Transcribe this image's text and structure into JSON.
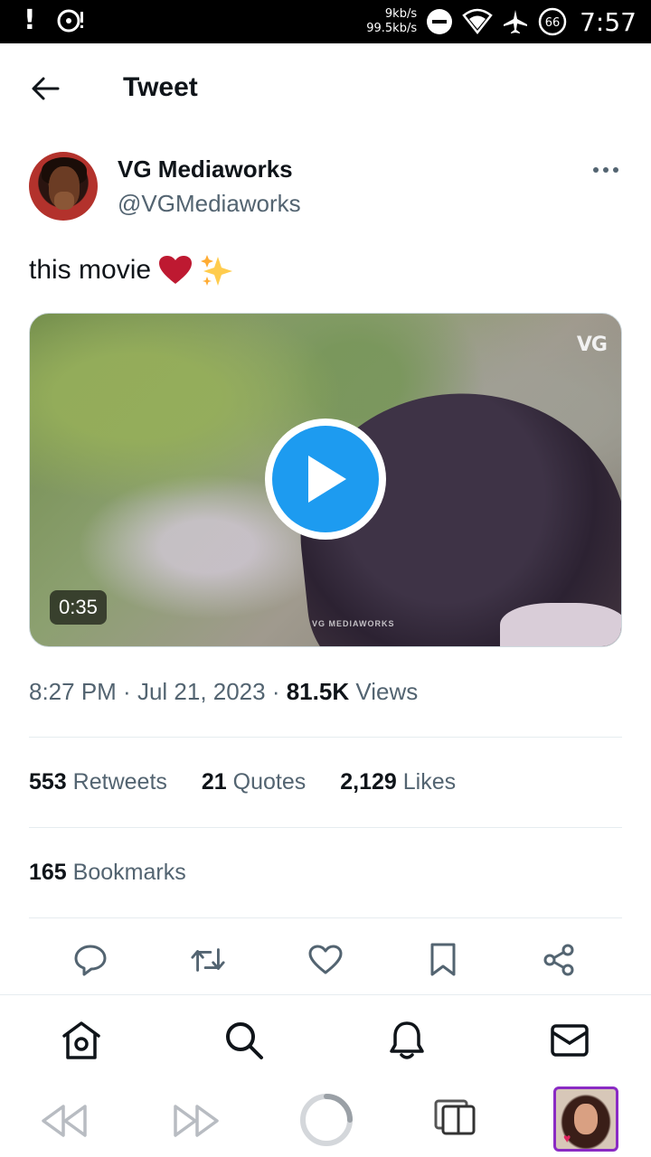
{
  "status_bar": {
    "speed_up": "9kb/s",
    "speed_down": "99.5kb/s",
    "battery": "66",
    "time": "7:57"
  },
  "header": {
    "title": "Tweet"
  },
  "tweet": {
    "author_name": "VG Mediaworks",
    "author_handle": "@VGMediaworks",
    "text": "this movie",
    "emoji_1": "heart",
    "emoji_2": "sparkles",
    "video": {
      "duration": "0:35",
      "logo": "VG",
      "watermark": "VG MEDIAWORKS"
    },
    "time": "8:27 PM",
    "date": "Jul 21, 2023",
    "views_count": "81.5K",
    "views_label": "Views"
  },
  "stats": {
    "retweets_count": "553",
    "retweets_label": "Retweets",
    "quotes_count": "21",
    "quotes_label": "Quotes",
    "likes_count": "2,129",
    "likes_label": "Likes",
    "bookmarks_count": "165",
    "bookmarks_label": "Bookmarks"
  },
  "actions": [
    "reply-icon",
    "retweet-icon",
    "like-icon",
    "bookmark-icon",
    "share-icon"
  ],
  "bottom_nav": [
    "home-icon",
    "search-icon",
    "notifications-icon",
    "messages-icon"
  ],
  "browser_bar": [
    "rewind-icon",
    "fast-forward-icon",
    "loading-icon",
    "tabs-icon",
    "thumbnail"
  ],
  "colors": {
    "accent": "#1d9bf0",
    "heart": "#e0245e",
    "secondary_text": "#536471"
  }
}
